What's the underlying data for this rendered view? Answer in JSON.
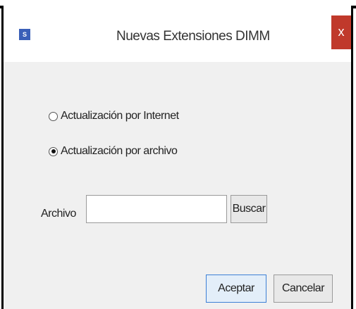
{
  "window": {
    "title": "Nuevas Extensiones DIMM",
    "app_icon": "app-logo-icon",
    "close_glyph": "x"
  },
  "options": {
    "internet_label": "Actualización por Internet",
    "file_label": "Actualización por archivo",
    "selected": "file"
  },
  "file": {
    "label": "Archivo",
    "value": "",
    "search_label": "Buscar"
  },
  "actions": {
    "accept_label": "Aceptar",
    "cancel_label": "Cancelar"
  },
  "colors": {
    "close_button": "#c0392b",
    "accent": "#3c7fd6",
    "dialog_body": "#f0f0f0"
  }
}
